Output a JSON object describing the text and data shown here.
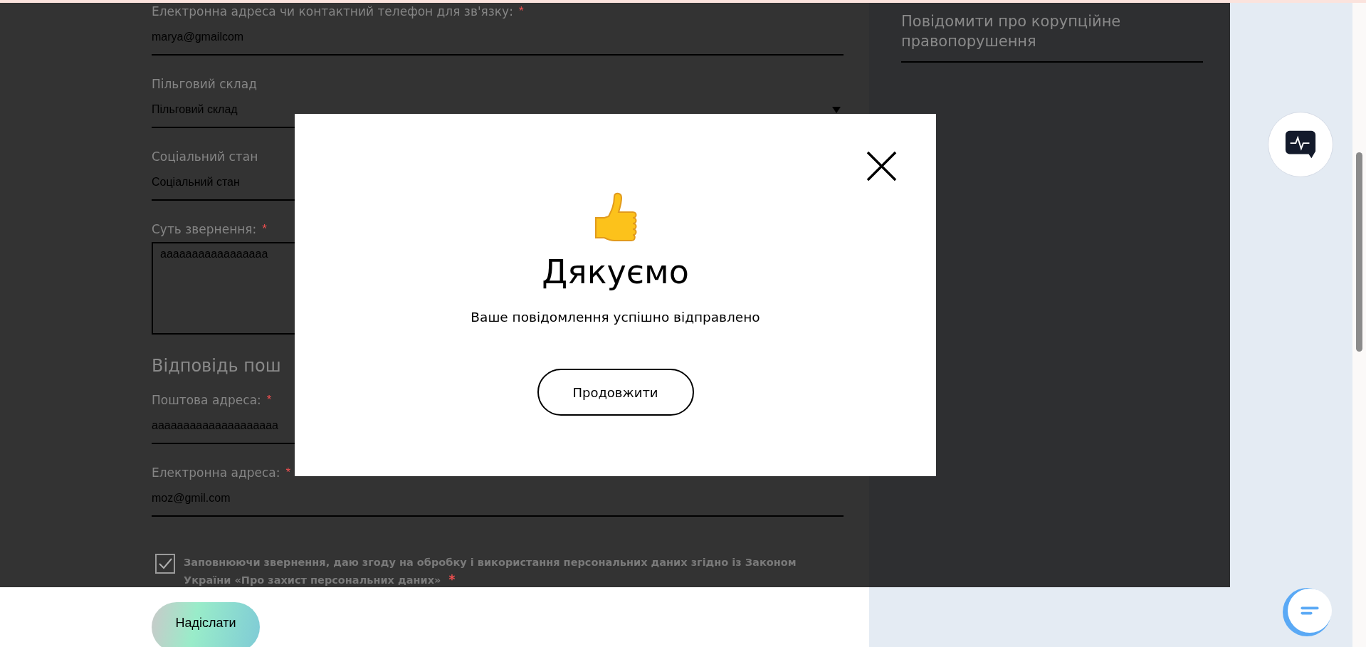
{
  "form": {
    "items": [
      {
        "kind": "input",
        "label": "Електронна адреса чи контактний телефон для зв'язку:",
        "required_mark": "*",
        "value": "marya@gmailcom"
      },
      {
        "kind": "select",
        "label": "Пільговий склад",
        "value": "Пільговий склад"
      },
      {
        "kind": "input",
        "label": "Соціальний стан",
        "value": "Соціальний стан"
      },
      {
        "kind": "textarea",
        "label": "Суть звернення:",
        "required_mark": "*",
        "value": "aaaaaaaaaaaaaaaaa"
      },
      {
        "kind": "heading",
        "label": "Відповідь пош"
      },
      {
        "kind": "input",
        "label": "Поштова адреса:",
        "required_mark": "*",
        "value": "aaaaaaaaaaaaaaaaaaaa"
      },
      {
        "kind": "input",
        "label": "Електронна адреса:",
        "required_mark": "*",
        "value": "moz@gmil.com"
      }
    ],
    "consent": {
      "checked": true,
      "text": "Заповнюючи звернення, даю згоду на обробку і використання персональних даних згідно із Законом України «Про захист персональних даних»",
      "required_mark": "*"
    },
    "submit_button": "Надіслати"
  },
  "sidebar": {
    "title": "Повідомити про корупційне правопорушення"
  },
  "modal": {
    "title": "Дякуємо",
    "message": "Ваше повідомлення успішно відправлено",
    "button": "Продовжити"
  }
}
